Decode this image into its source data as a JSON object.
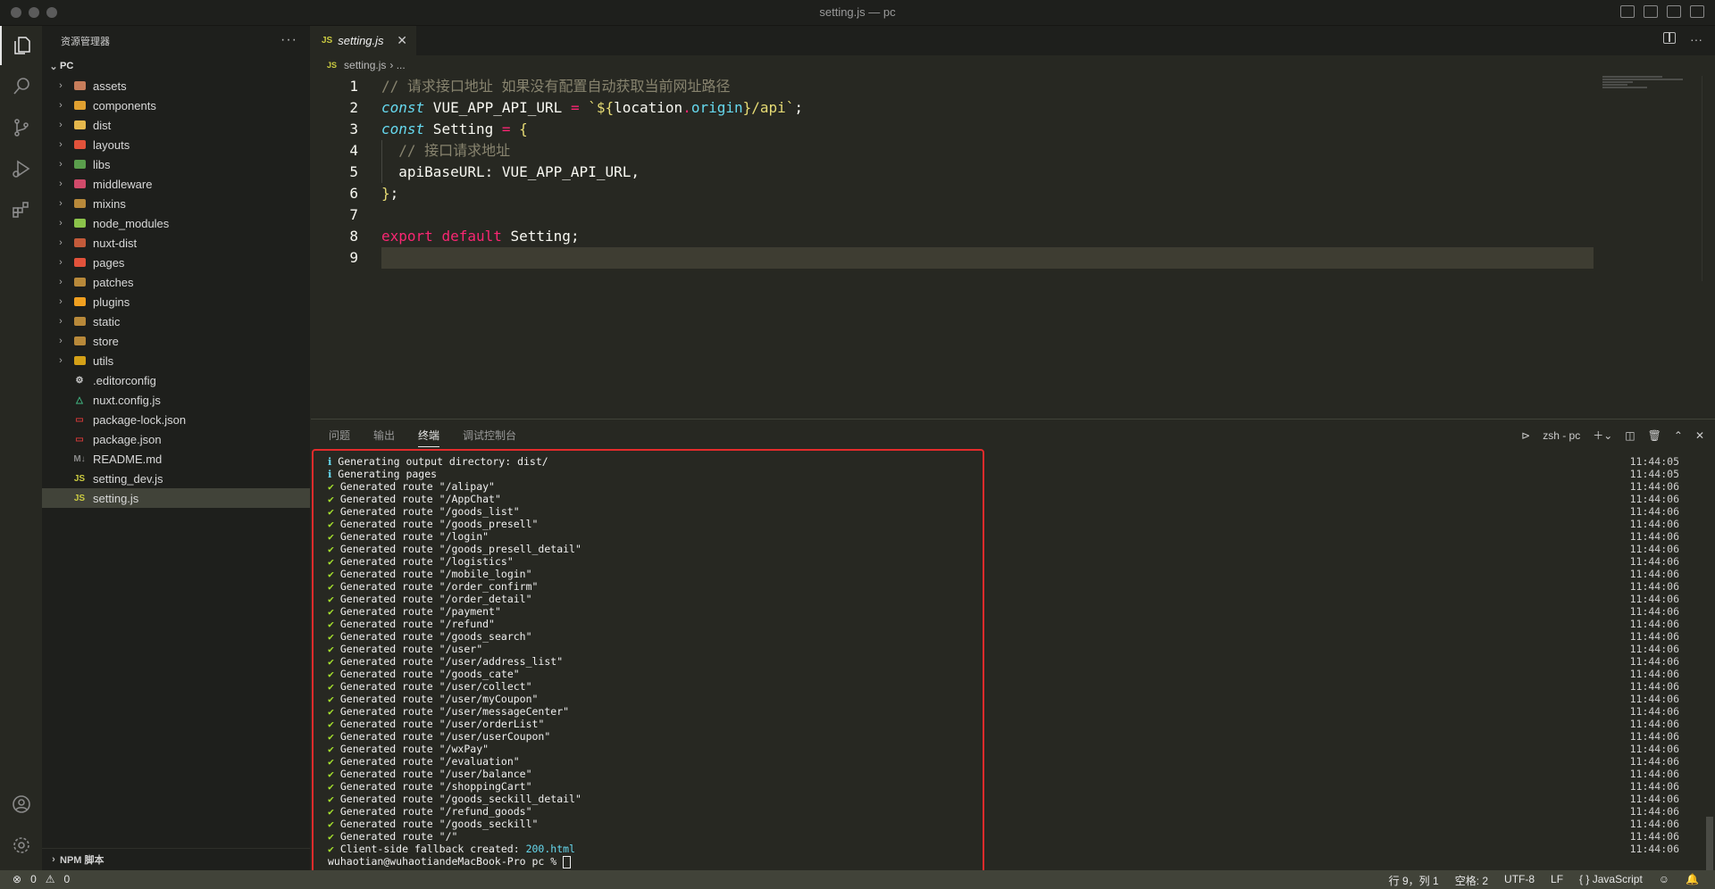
{
  "window": {
    "title": "setting.js — pc"
  },
  "sidebar": {
    "title": "资源管理器",
    "more": "···",
    "root": "PC",
    "items": [
      {
        "label": "assets",
        "type": "folder",
        "color": "#c77d5b"
      },
      {
        "label": "components",
        "type": "folder",
        "color": "#e0a030"
      },
      {
        "label": "dist",
        "type": "folder",
        "color": "#e5b84c"
      },
      {
        "label": "layouts",
        "type": "folder",
        "color": "#e2523b"
      },
      {
        "label": "libs",
        "type": "folder",
        "color": "#5a9e4c"
      },
      {
        "label": "middleware",
        "type": "folder",
        "color": "#d04a6a"
      },
      {
        "label": "mixins",
        "type": "folder",
        "color": "#b8893a"
      },
      {
        "label": "node_modules",
        "type": "folder",
        "color": "#8bc34a"
      },
      {
        "label": "nuxt-dist",
        "type": "folder",
        "color": "#c35a3a"
      },
      {
        "label": "pages",
        "type": "folder",
        "color": "#e2523b"
      },
      {
        "label": "patches",
        "type": "folder",
        "color": "#b8893a"
      },
      {
        "label": "plugins",
        "type": "folder",
        "color": "#f0a020"
      },
      {
        "label": "static",
        "type": "folder",
        "color": "#b8893a"
      },
      {
        "label": "store",
        "type": "folder",
        "color": "#b8893a"
      },
      {
        "label": "utils",
        "type": "folder",
        "color": "#d4a017"
      },
      {
        "label": ".editorconfig",
        "type": "file",
        "icon": "⚙",
        "color": "#d0d0d0"
      },
      {
        "label": "nuxt.config.js",
        "type": "file",
        "icon": "△",
        "color": "#41b883"
      },
      {
        "label": "package-lock.json",
        "type": "file",
        "icon": "npm",
        "color": "#cb3837"
      },
      {
        "label": "package.json",
        "type": "file",
        "icon": "npm",
        "color": "#cb3837"
      },
      {
        "label": "README.md",
        "type": "file",
        "icon": "M↓",
        "color": "#8a8a8a"
      },
      {
        "label": "setting_dev.js",
        "type": "file",
        "icon": "JS",
        "color": "#cbcb41"
      },
      {
        "label": "setting.js",
        "type": "file",
        "icon": "JS",
        "color": "#cbcb41",
        "selected": true
      }
    ],
    "npm_section": "NPM 脚本"
  },
  "editor": {
    "tab_badge": "JS",
    "tab_label": "setting.js",
    "tab_close": "✕",
    "breadcrumb_file": "setting.js",
    "breadcrumb_rest": "› ...",
    "current_line": 9,
    "line_numbers": [
      "1",
      "2",
      "3",
      "4",
      "5",
      "6",
      "7",
      "8",
      "9"
    ]
  },
  "panel": {
    "tabs": [
      "问题",
      "输出",
      "终端",
      "调试控制台"
    ],
    "active_tab": "终端",
    "terminal_name": "zsh - pc",
    "info_lines": [
      "Generating output directory: dist/",
      "Generating pages"
    ],
    "routes": [
      "/alipay",
      "/AppChat",
      "/goods_list",
      "/goods_presell",
      "/login",
      "/goods_presell_detail",
      "/logistics",
      "/mobile_login",
      "/order_confirm",
      "/order_detail",
      "/payment",
      "/refund",
      "/goods_search",
      "/user",
      "/user/address_list",
      "/goods_cate",
      "/user/collect",
      "/user/myCoupon",
      "/user/messageCenter",
      "/user/orderList",
      "/user/userCoupon",
      "/wxPay",
      "/evaluation",
      "/user/balance",
      "/shoppingCart",
      "/goods_seckill_detail",
      "/refund_goods",
      "/goods_seckill",
      "/"
    ],
    "route_prefix": "Generated route ",
    "fallback_text": "Client-side fallback created: ",
    "fallback_file": "200.html",
    "prompt": "wuhaotian@wuhaotiandeMacBook-Pro pc % ",
    "timestamps": [
      "11:44:05",
      "11:44:05",
      "11:44:06",
      "11:44:06",
      "11:44:06",
      "11:44:06",
      "11:44:06",
      "11:44:06",
      "11:44:06",
      "11:44:06",
      "11:44:06",
      "11:44:06",
      "11:44:06",
      "11:44:06",
      "11:44:06",
      "11:44:06",
      "11:44:06",
      "11:44:06",
      "11:44:06",
      "11:44:06",
      "11:44:06",
      "11:44:06",
      "11:44:06",
      "11:44:06",
      "11:44:06",
      "11:44:06",
      "11:44:06",
      "11:44:06",
      "11:44:06",
      "11:44:06",
      "11:44:06",
      "11:44:06"
    ]
  },
  "statusbar": {
    "errors": "0",
    "warnings": "0",
    "position": "行 9，列 1",
    "spaces": "空格: 2",
    "encoding": "UTF-8",
    "eol": "LF",
    "language_icon": "{ }",
    "language": "JavaScript"
  }
}
